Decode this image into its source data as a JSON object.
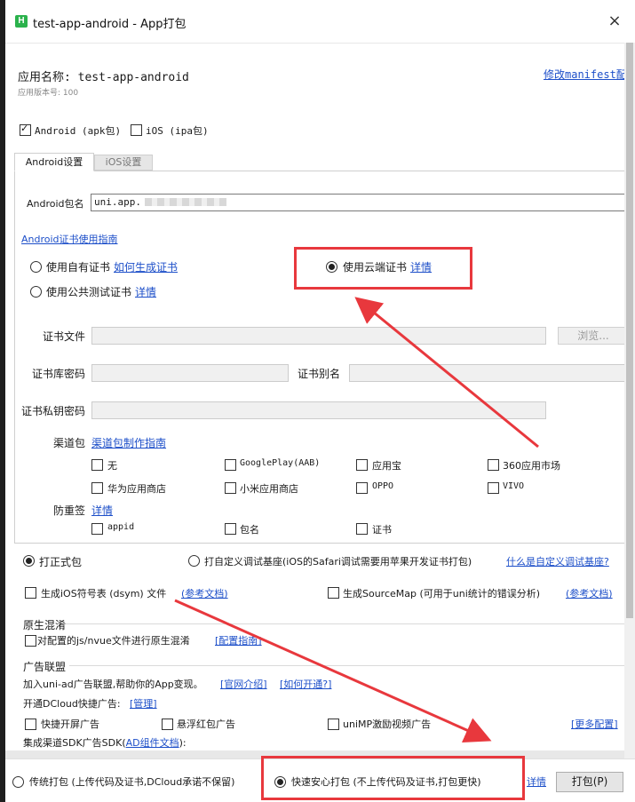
{
  "window": {
    "title": "test-app-android - App打包",
    "close_glyph": "×"
  },
  "app": {
    "name_label": "应用名称: test-app-android",
    "version_label": "应用版本号: 100",
    "manifest_link": "修改manifest配置"
  },
  "platforms": [
    {
      "label": "Android (apk包)",
      "checked": true
    },
    {
      "label": "iOS (ipa包)",
      "checked": false
    }
  ],
  "tabs": [
    {
      "label": "Android设置",
      "active": true
    },
    {
      "label": "iOS设置",
      "active": false
    }
  ],
  "android": {
    "package_label": "Android包名",
    "package_value": "uni.app.",
    "cert_guide_link": "Android证书使用指南",
    "cert_options": {
      "own": {
        "label": "使用自有证书",
        "link": "如何生成证书",
        "checked": false
      },
      "public": {
        "label": "使用公共测试证书",
        "link": "详情",
        "checked": false
      },
      "cloud": {
        "label": "使用云端证书",
        "link": "详情",
        "checked": true
      }
    },
    "cert_file_label": "证书文件",
    "browse_button": "浏览...",
    "keystore_password_label": "证书库密码",
    "alias_label": "证书别名",
    "private_key_label": "证书私钥密码",
    "channel_label": "渠道包",
    "channel_guide_link": "渠道包制作指南",
    "channels": [
      "无",
      "GooglePlay(AAB)",
      "应用宝",
      "360应用市场",
      "华为应用商店",
      "小米应用商店",
      "OPPO",
      "VIVO"
    ],
    "anti_resign_label": "防重签",
    "anti_resign_link": "详情",
    "anti_resign_options": [
      "appid",
      "包名",
      "证书"
    ]
  },
  "build_type": {
    "formal": {
      "label": "打正式包",
      "checked": true
    },
    "custom": {
      "label": "打自定义调试基座(iOS的Safari调试需要用苹果开发证书打包)",
      "checked": false
    },
    "custom_link": "什么是自定义调试基座?"
  },
  "dsym": {
    "label": "生成iOS符号表 (dsym) 文件",
    "link": "(参考文档)",
    "checked": false
  },
  "sourcemap": {
    "label": "生成SourceMap (可用于uni统计的错误分析)",
    "link": "(参考文档)",
    "checked": false
  },
  "obfuscation": {
    "section_title": "原生混淆",
    "label": "对配置的js/nvue文件进行原生混淆",
    "link": "[配置指南]",
    "checked": false
  },
  "ads": {
    "section_title": "广告联盟",
    "join_text": "加入uni-ad广告联盟,帮助你的App变现。",
    "intro_link": "[官网介绍]",
    "how_link": "[如何开通?]",
    "dcloud_text": "开通DCloud快捷广告:",
    "manage_link": "[管理]",
    "options": [
      {
        "label": "快捷开屏广告",
        "checked": false
      },
      {
        "label": "悬浮红包广告",
        "checked": false
      },
      {
        "label": "uniMP激励视频广告",
        "checked": false
      }
    ],
    "more_link": "[更多配置]",
    "sdk_text": "集成渠道SDK广告SDK(",
    "sdk_link": "AD组件文档",
    "sdk_suffix": "):"
  },
  "footer": {
    "traditional": {
      "label": "传统打包 (上传代码及证书,DCloud承诺不保留)",
      "checked": false
    },
    "fast": {
      "label": "快速安心打包 (不上传代码及证书,打包更快)",
      "checked": true
    },
    "detail_link": "详情",
    "pack_button": "打包(P)"
  },
  "colors": {
    "annotation": "#e8383d",
    "link": "#1d4fc9",
    "app_icon": "#2bb24c"
  }
}
